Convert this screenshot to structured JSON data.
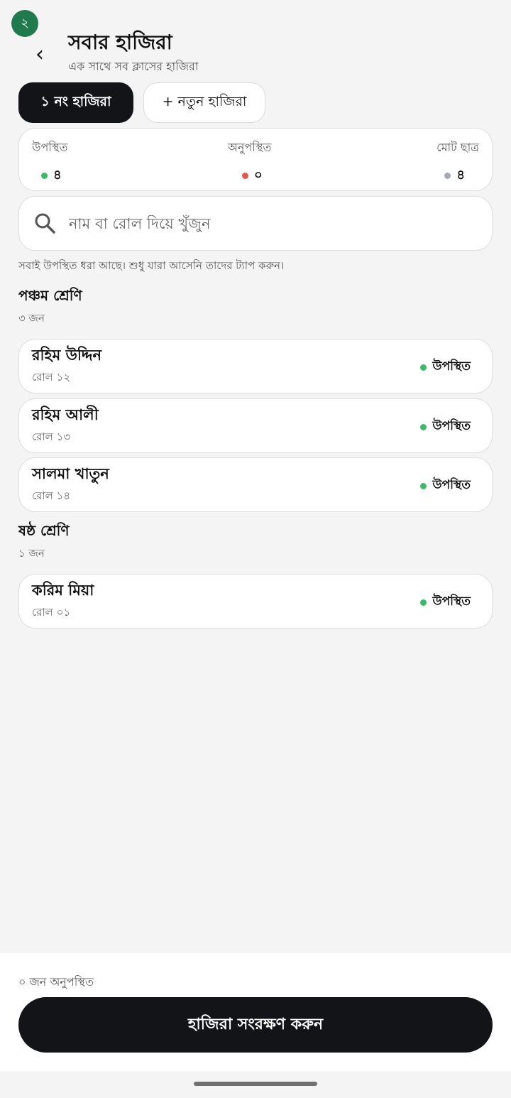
{
  "header": {
    "step_badge": "২",
    "back_glyph": "‹",
    "title": "সবার হাজিরা",
    "subtitle": "এক সাথে সব ক্লাসের হাজিরা"
  },
  "tabs": [
    {
      "label": "১ নং হাজিরা",
      "active": true
    },
    {
      "label": "+ নতুন হাজিরা",
      "active": false
    }
  ],
  "summary": {
    "present": {
      "label": "উপস্থিত",
      "value": "৪",
      "color": "#3cba6a"
    },
    "absent": {
      "label": "অনুপস্থিত",
      "value": "০",
      "color": "#e0574f"
    },
    "total": {
      "label": "মোট ছাত্র",
      "value": "৪",
      "color": "#a7abb1"
    }
  },
  "search": {
    "placeholder": "নাম বা রোল দিয়ে খুঁজুন",
    "icon": "search-icon"
  },
  "hint": "সবাই উপস্থিত ধরা আছে। শুধু যারা আসেনি তাদের ট্যাপ করুন।",
  "groups": [
    {
      "title": "পঞ্চম শ্রেণি",
      "count": "৩ জন",
      "students": [
        {
          "name": "রহিম উদ্দিন",
          "roll": "রোল ১২",
          "status": "উপস্থিত"
        },
        {
          "name": "রহিম আলী",
          "roll": "রোল ১৩",
          "status": "উপস্থিত"
        },
        {
          "name": "সালমা খাতুন",
          "roll": "রোল ১৪",
          "status": "উপস্থিত"
        }
      ]
    },
    {
      "title": "ষষ্ঠ শ্রেণি",
      "count": "১ জন",
      "students": [
        {
          "name": "করিম মিয়া",
          "roll": "রোল ০১",
          "status": "উপস্থিত"
        }
      ]
    }
  ],
  "footer": {
    "absent_count": "০ জন অনুপস্থিত",
    "save_label": "হাজিরা সংরক্ষণ করুন"
  },
  "colors": {
    "accent_dark": "#121417",
    "badge_green": "#1f7a4d",
    "present_dot": "#3cba6a"
  }
}
